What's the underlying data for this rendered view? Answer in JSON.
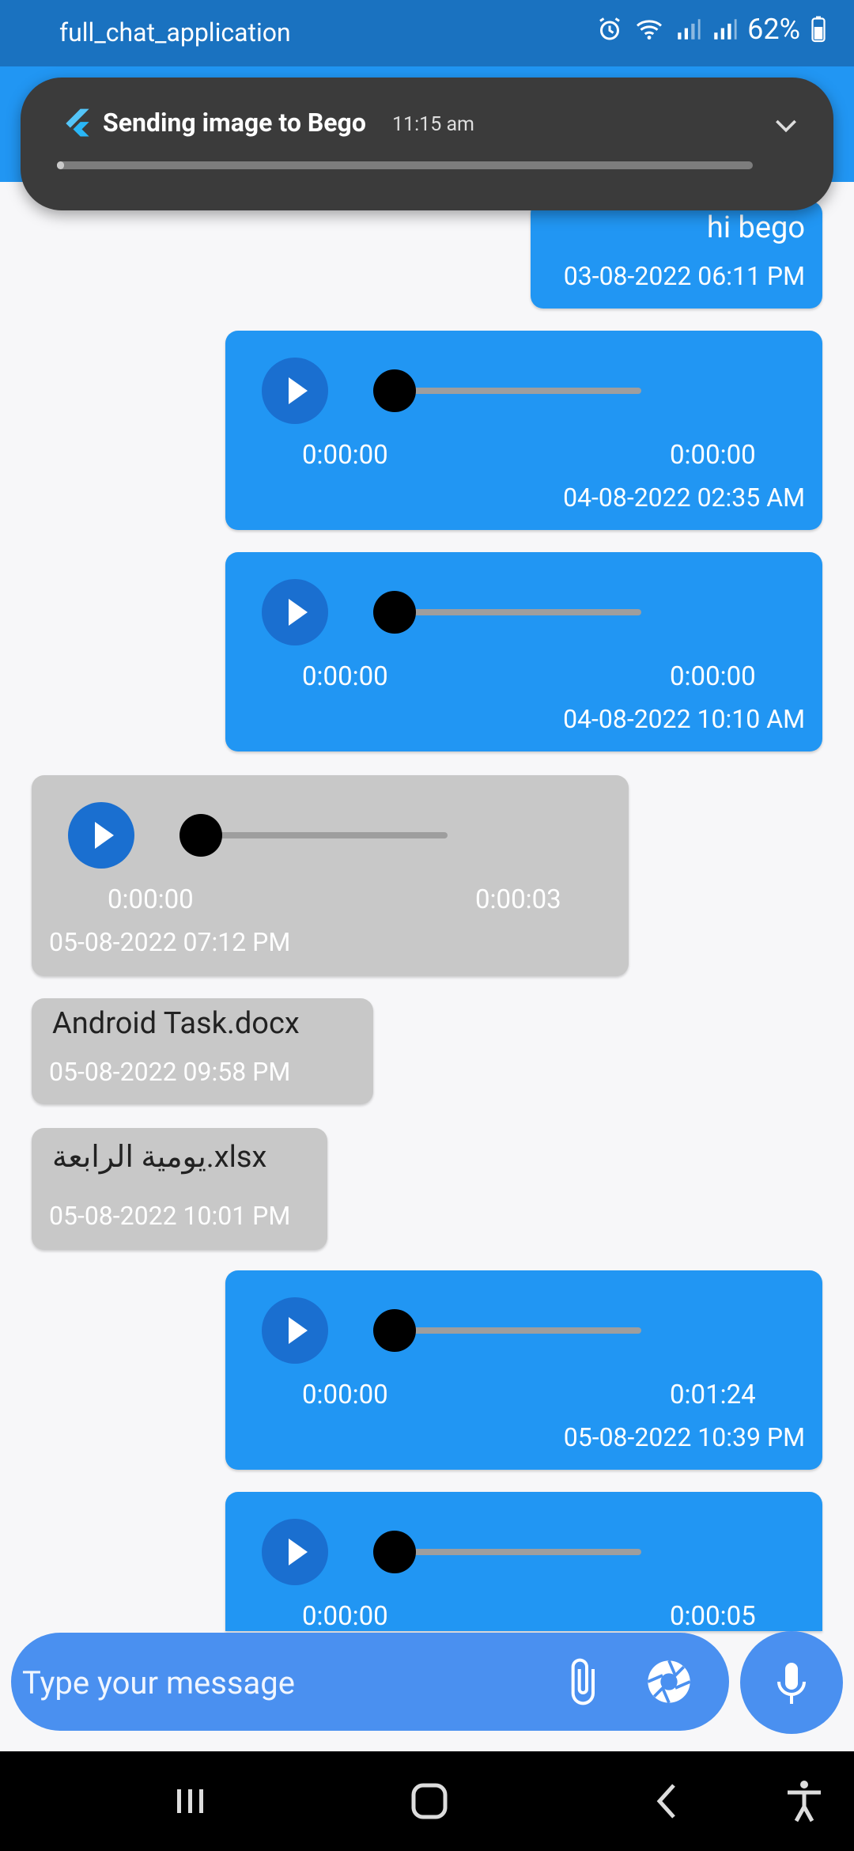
{
  "status_bar": {
    "app_name": "full_chat_application",
    "battery": "62%"
  },
  "notification": {
    "title": "Sending image to Bego",
    "time": "11:15 am",
    "progress": 0.01
  },
  "messages": [
    {
      "type": "text",
      "side": "sent",
      "text": "hi bego",
      "timestamp": "03-08-2022 06:11 PM"
    },
    {
      "type": "audio",
      "side": "sent",
      "position": "0:00:00",
      "duration": "0:00:00",
      "timestamp": "04-08-2022 02:35 AM"
    },
    {
      "type": "audio",
      "side": "sent",
      "position": "0:00:00",
      "duration": "0:00:00",
      "timestamp": "04-08-2022 10:10 AM"
    },
    {
      "type": "audio",
      "side": "recv",
      "position": "0:00:00",
      "duration": "0:00:03",
      "timestamp": "05-08-2022 07:12 PM"
    },
    {
      "type": "file",
      "side": "recv",
      "text": "Android Task.docx",
      "timestamp": "05-08-2022 09:58 PM"
    },
    {
      "type": "file",
      "side": "recv",
      "text": "يومية الرابعة.xlsx",
      "timestamp": "05-08-2022 10:01 PM"
    },
    {
      "type": "audio",
      "side": "sent",
      "position": "0:00:00",
      "duration": "0:01:24",
      "timestamp": "05-08-2022 10:39 PM"
    },
    {
      "type": "audio",
      "side": "sent",
      "position": "0:00:00",
      "duration": "0:00:05",
      "timestamp": ""
    }
  ],
  "input": {
    "placeholder": "Type your message"
  },
  "colors": {
    "sent_bubble": "#2196f3",
    "recv_bubble": "#c8c8c8",
    "app_bar": "#2196f3",
    "status_bar": "#1a72c0"
  }
}
